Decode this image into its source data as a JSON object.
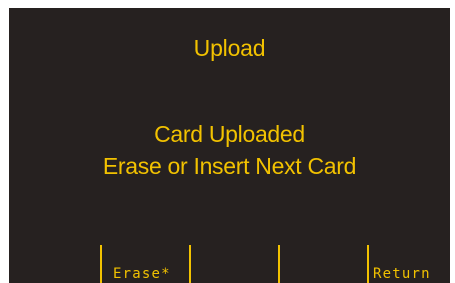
{
  "screen": {
    "title": "Upload",
    "message_line1": "Card Uploaded",
    "message_line2": "Erase or Insert Next Card"
  },
  "softkeys": [
    {
      "label": ""
    },
    {
      "label": "Erase*"
    },
    {
      "label": ""
    },
    {
      "label": ""
    },
    {
      "label": "Return"
    }
  ],
  "colors": {
    "background": "#262120",
    "text": "#f2c200"
  }
}
